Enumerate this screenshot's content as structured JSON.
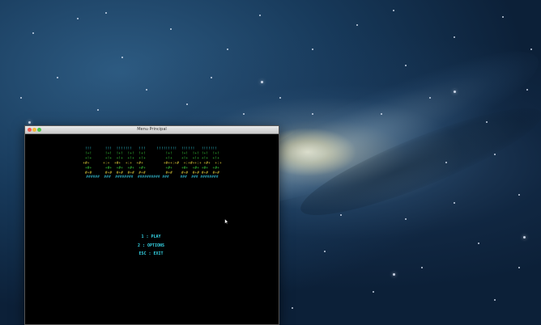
{
  "window": {
    "title": "Menu Principal"
  },
  "game": {
    "logo_rows": [
      " !!!      !!!  !!!!!!!   !!!     !!!!!!!!!  !!!!!!   !!!!!!! ",
      " !+!      !+!  !+!  !+!  !+!         !+!    !+!  !+! !+!  !+!",
      " +!+      +!+  +!+  +!+  +!+         +!+    +!+  +!+ +!+  +!+",
      " +#+      +:+  +#+  +:+  +#+         +#++:+#  +:+#++:+ +#+  +:+",
      " +#+      +#+  +#+  +#+  +#+         +#+    +#+  +#+ +#+  +#+",
      " #+#      #+#  #+#  #+#  #+#         #+#    #+#  #+# #+#  #+#",
      "  ######  ###  ########  ########## ###     ###  ### ######## "
    ],
    "row_colors": [
      "#2fd0e0",
      "#3bd23b",
      "#3bd23b",
      "#e6d23a",
      "#3bd23b",
      "#e6d23a",
      "#36c8e0"
    ],
    "menu": {
      "play": "1 : PLAY",
      "options": "2 : OPTIONS",
      "exit": "ESC : EXIT"
    }
  },
  "icons": {
    "close": "close-icon",
    "minimize": "minimize-icon",
    "maximize": "maximize-icon",
    "cursor": "mouse-pointer-icon"
  }
}
